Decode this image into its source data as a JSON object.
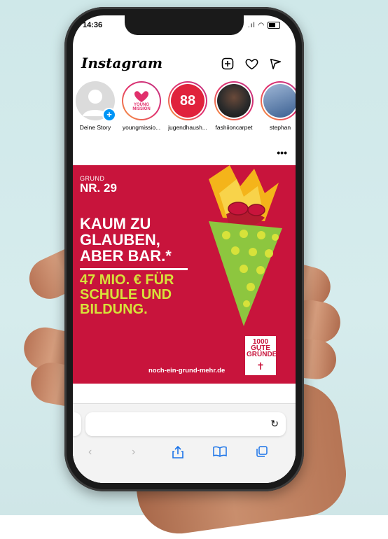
{
  "status": {
    "time": "14:36",
    "signal": ".ıl"
  },
  "instagram": {
    "logo": "Instagram",
    "icons": [
      "new-post-icon",
      "heart-icon",
      "send-icon"
    ]
  },
  "stories": [
    {
      "label": "Deine Story",
      "avatar_text": ""
    },
    {
      "label": "youngmissio...",
      "avatar_text": "YOUNG MISSION"
    },
    {
      "label": "jugendhaush...",
      "avatar_text": "88"
    },
    {
      "label": "fashiioncarpet",
      "avatar_text": ""
    },
    {
      "label": "stephan",
      "avatar_text": ""
    }
  ],
  "post": {
    "more": "•••",
    "grund": "GRUND",
    "nr": "NR. 29",
    "headline": "KAUM ZU GLAUBEN, ABER BAR.*",
    "sub": "47 MIO. € FÜR SCHULE UND BILDUNG.",
    "url": "noch-ein-grund-mehr.de",
    "badge": "1000 GUTE GRÜNDE"
  },
  "safari": {
    "reload": "↻",
    "toolbar": [
      "back",
      "forward",
      "share",
      "bookmarks",
      "tabs"
    ]
  },
  "colors": {
    "post_bg": "#c8143c",
    "accent_yellow": "#d7e23a",
    "ig_ring": "#e1306c"
  }
}
